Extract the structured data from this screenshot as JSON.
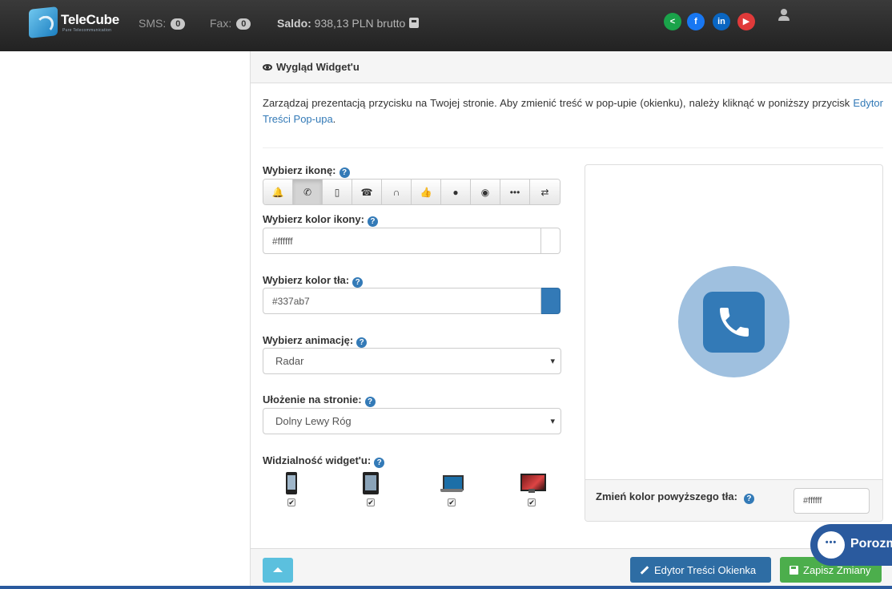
{
  "navbar": {
    "brand": "TeleCube",
    "brand_sub": "Pure Telecommunication",
    "sms_label": "SMS:",
    "sms_count": "0",
    "fax_label": "Fax:",
    "fax_count": "0",
    "saldo_label": "Saldo:",
    "saldo_value": "938,13 PLN brutto",
    "social": {
      "share": "<",
      "facebook": "f",
      "linkedin": "in",
      "youtube": "▶"
    }
  },
  "panel": {
    "title": "Wygląd Widget'u",
    "intro_text": "Zarządzaj prezentacją przycisku na Twojej stronie. Aby zmienić treść w pop-upie (okienku), należy kliknąć w poniższy przycisk ",
    "intro_link": "Edytor Treści Pop-upa",
    "intro_end": ".",
    "icon_label": "Wybierz ikonę:",
    "icons": [
      "bell-icon",
      "phone-icon",
      "mobile-icon",
      "telephone-icon",
      "headset-icon",
      "thumbs-up-icon",
      "globe-icon",
      "record-icon",
      "dots-icon",
      "transfer-icon"
    ],
    "icon_glyphs": [
      "🔔",
      "✆",
      "▯",
      "☎",
      "∩",
      "👍",
      "●",
      "◉",
      "•••",
      "⇄"
    ],
    "icon_color_label": "Wybierz kolor ikony:",
    "icon_color_value": "#ffffff",
    "bg_color_label": "Wybierz kolor tła:",
    "bg_color_value": "#337ab7",
    "animation_label": "Wybierz animację:",
    "animation_value": "Radar",
    "position_label": "Ułożenie na stronie:",
    "position_value": "Dolny Lewy Róg",
    "visibility_label": "Widzialność widget'u:",
    "check": "✔",
    "preview_bg_label": "Zmień kolor powyższego tła:",
    "preview_bg_value": "#ffffff"
  },
  "footer": {
    "editor_button": "Edytor Treści Okienka",
    "save_button": "Zapisz Zmiany"
  },
  "chat": {
    "label": "Porozmawiaj"
  },
  "colors": {
    "primary": "#337ab7",
    "success": "#4cae4c",
    "info": "#5bc0de",
    "radar": "#9fc0df"
  }
}
